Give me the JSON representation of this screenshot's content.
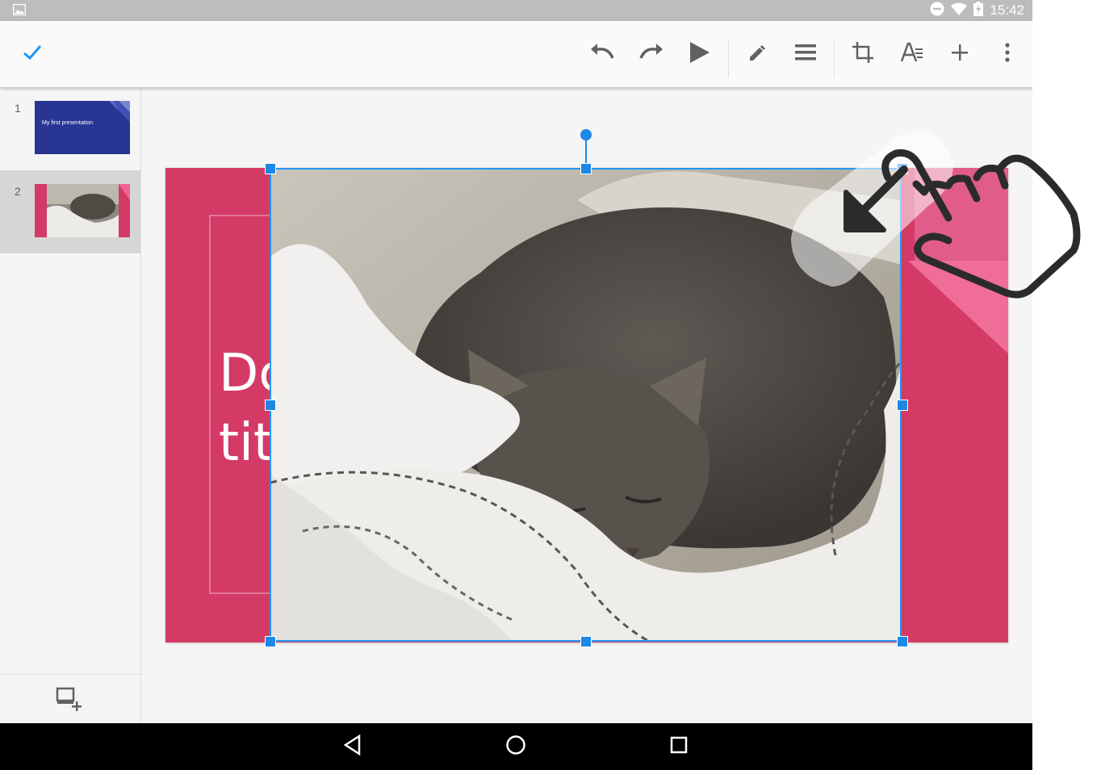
{
  "status_bar": {
    "time": "15:42",
    "icons": [
      "image-notification-icon",
      "do-not-disturb-icon",
      "wifi-icon",
      "battery-charging-icon"
    ]
  },
  "toolbar": {
    "done": "check-icon",
    "buttons": [
      "undo-icon",
      "redo-icon",
      "present-icon",
      "pen-icon",
      "align-icon",
      "crop-icon",
      "text-format-icon",
      "add-icon",
      "more-vert-icon"
    ]
  },
  "filmstrip": {
    "slides": [
      {
        "number": "1",
        "title": "My first presentation",
        "bg": "#283593"
      },
      {
        "number": "2",
        "selected": true
      }
    ],
    "new_slide": "add-slide-icon"
  },
  "slide": {
    "title": "Dc\ntit",
    "bg": "#d43a66"
  },
  "colors": {
    "selection": "#1e88e5",
    "slide_pink": "#d43a66",
    "theme_blue": "#283593"
  },
  "gesture": "drag-to-resize-hand-icon",
  "nav": [
    "back-icon",
    "home-icon",
    "recents-icon"
  ]
}
